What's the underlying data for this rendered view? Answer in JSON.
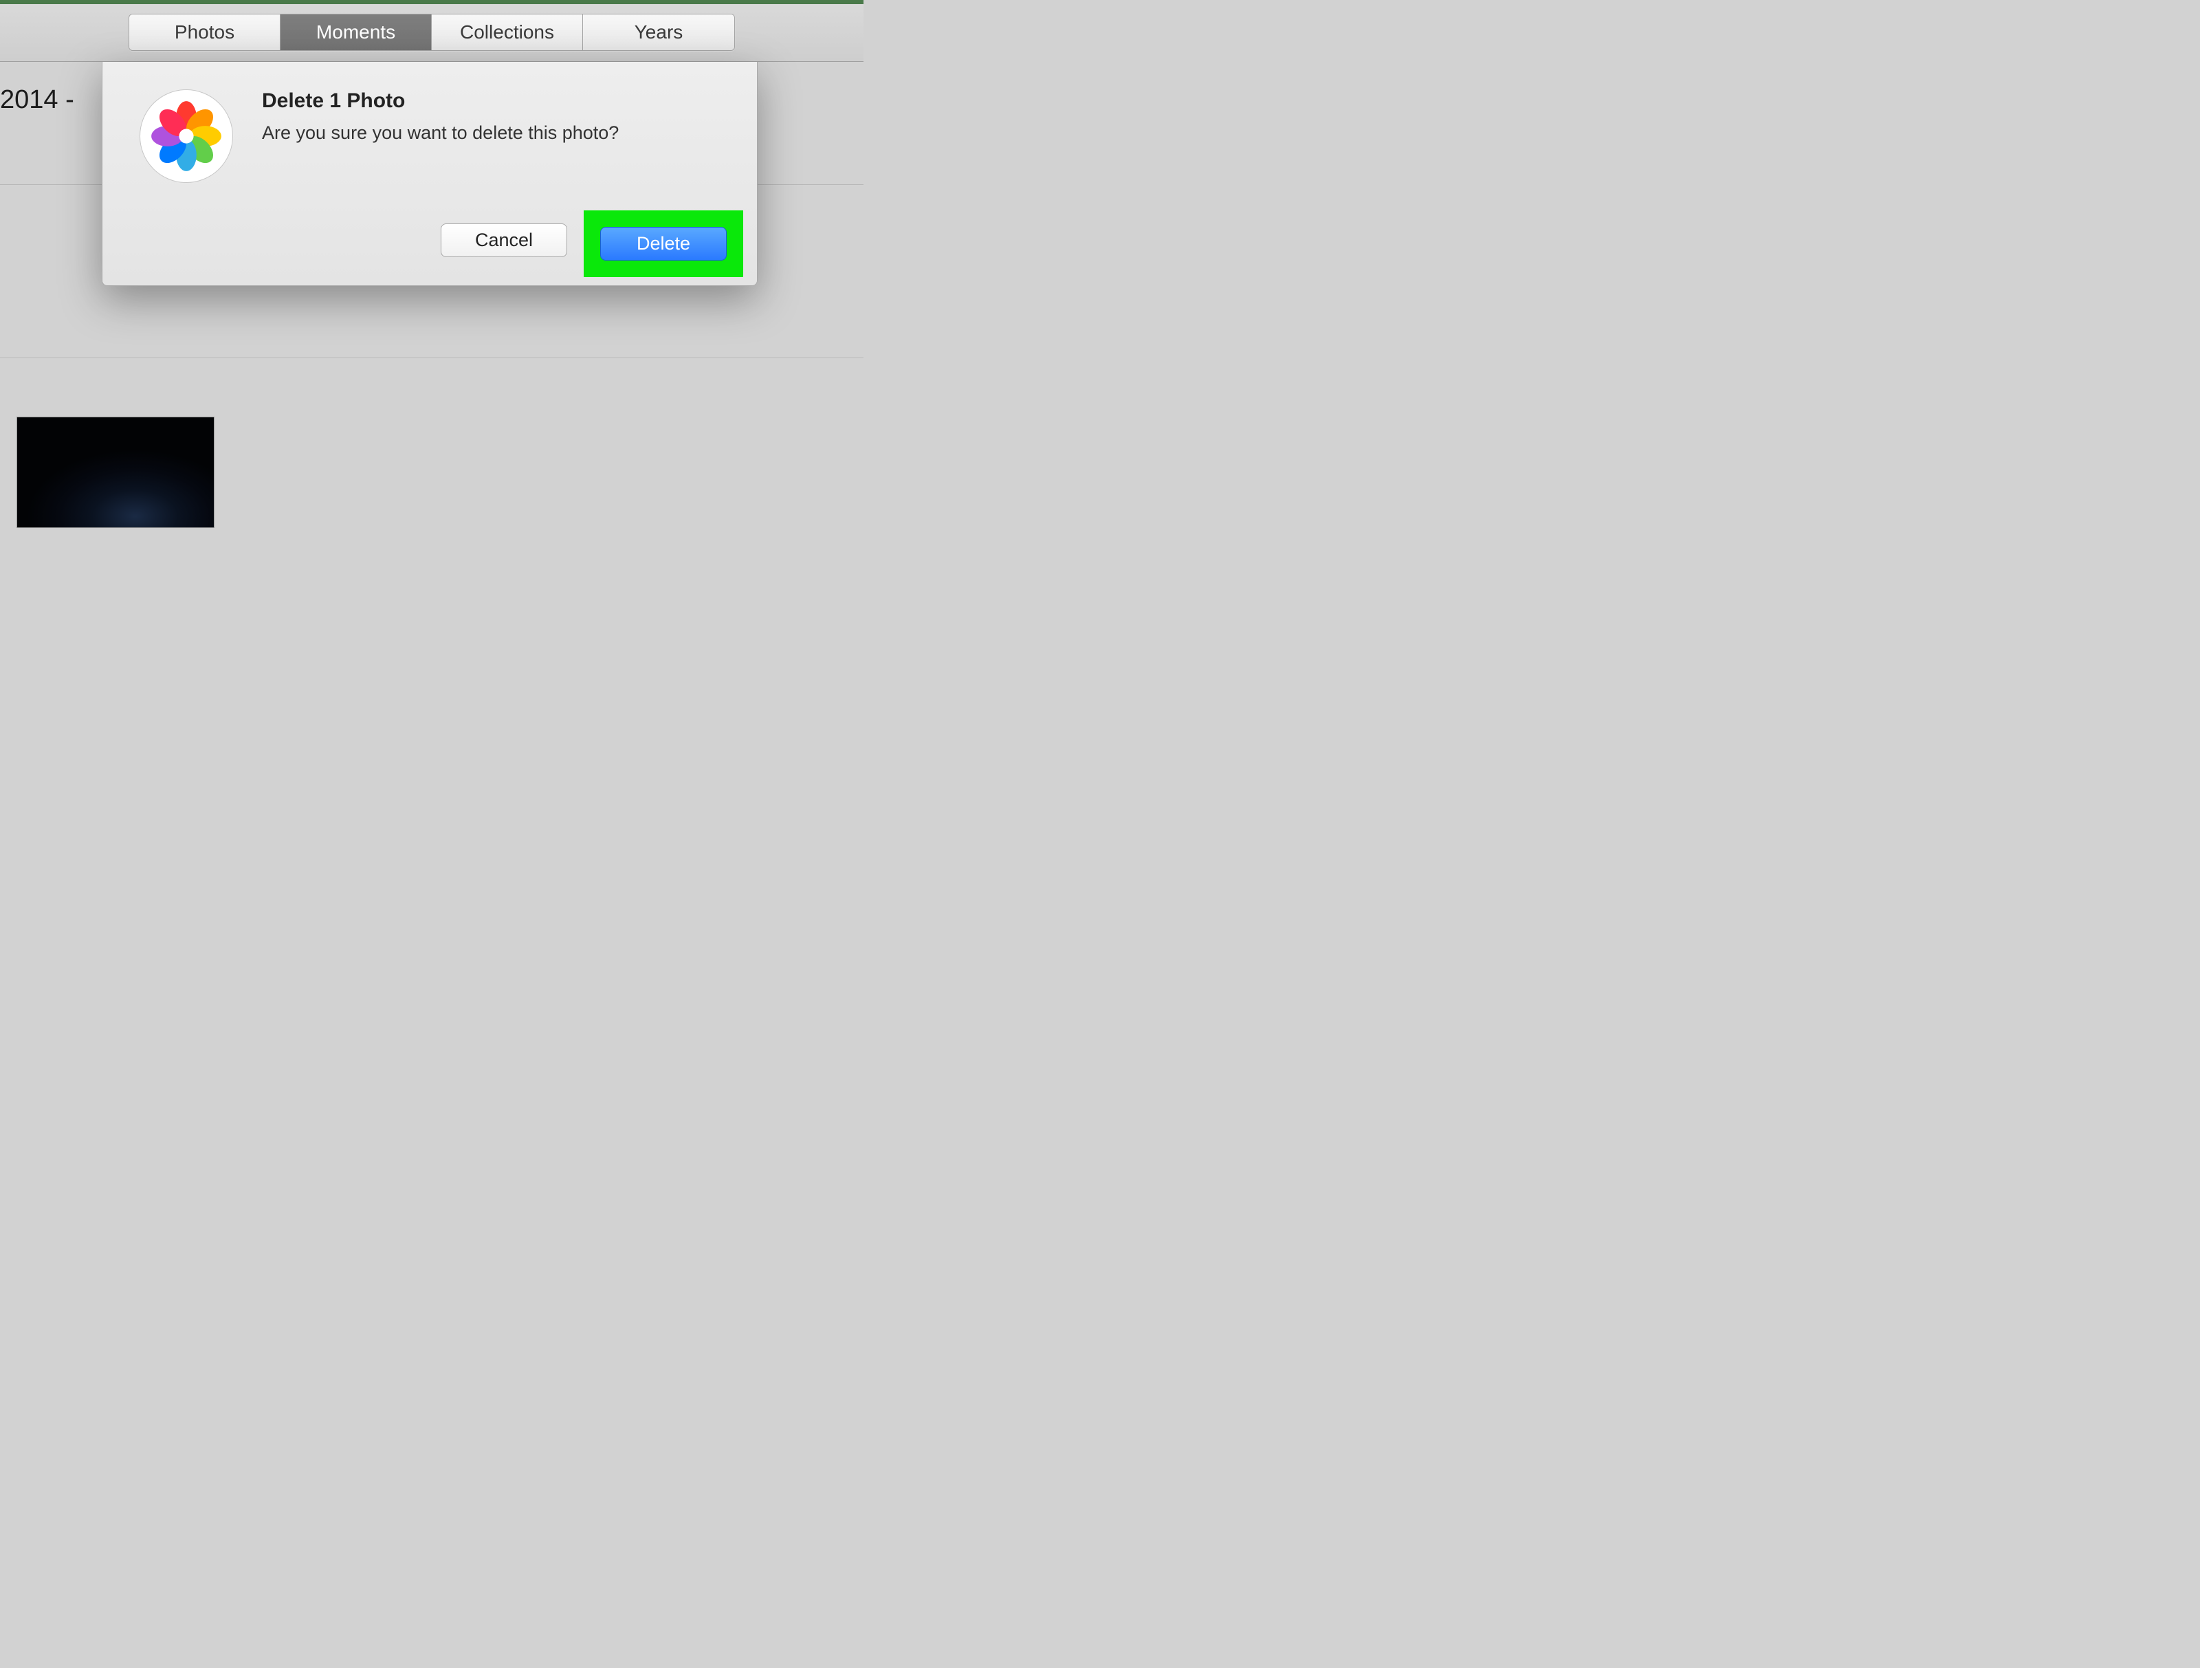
{
  "tabs": {
    "photos": "Photos",
    "moments": "Moments",
    "collections": "Collections",
    "years": "Years",
    "selected": "Moments"
  },
  "content": {
    "year_header": "2014 -"
  },
  "dialog": {
    "title": "Delete 1 Photo",
    "message": "Are you sure you want to delete this photo?",
    "cancel": "Cancel",
    "confirm": "Delete"
  }
}
